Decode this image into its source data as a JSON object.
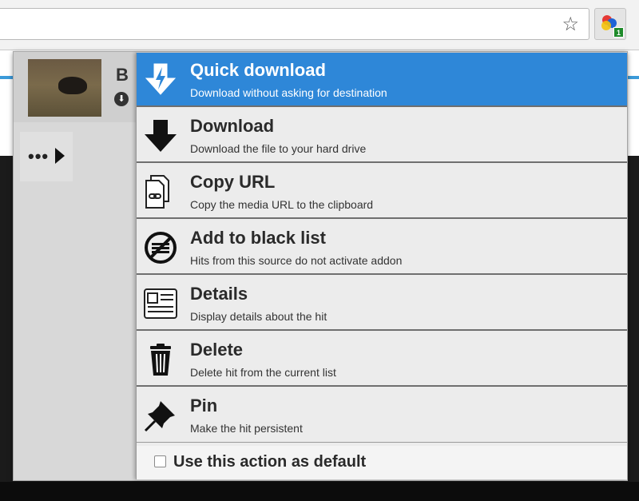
{
  "toolbar": {
    "star_icon": "star-icon",
    "extension_badge": "1"
  },
  "hit": {
    "title_initial": "B",
    "more_label": "•••"
  },
  "menu": {
    "items": [
      {
        "title": "Quick download",
        "desc": "Download without asking for destination",
        "icon": "quick-download-icon"
      },
      {
        "title": "Download",
        "desc": "Download the file to your hard drive",
        "icon": "download-arrow-icon"
      },
      {
        "title": "Copy URL",
        "desc": "Copy the media URL to the clipboard",
        "icon": "copy-url-icon"
      },
      {
        "title": "Add to black list",
        "desc": "Hits from this source do not activate addon",
        "icon": "blacklist-icon"
      },
      {
        "title": "Details",
        "desc": "Display details about the hit",
        "icon": "details-icon"
      },
      {
        "title": "Delete",
        "desc": "Delete hit from the current list",
        "icon": "trash-icon"
      },
      {
        "title": "Pin",
        "desc": "Make the hit persistent",
        "icon": "pin-icon"
      }
    ],
    "default_label": "Use this action as default"
  },
  "colors": {
    "selected": "#2e87d8",
    "separator": "#6f6f6f"
  }
}
